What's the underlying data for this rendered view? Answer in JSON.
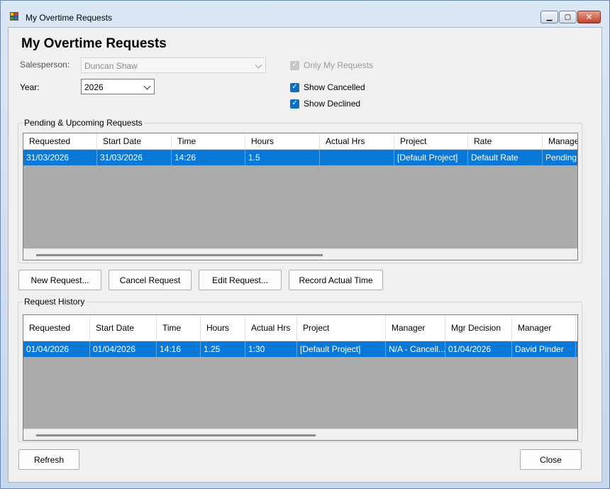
{
  "window": {
    "title": "My Overtime Requests"
  },
  "page_title": "My Overtime Requests",
  "filters": {
    "salesperson_label": "Salesperson:",
    "salesperson_value": "Duncan Shaw",
    "year_label": "Year:",
    "year_value": "2026",
    "only_my_requests": "Only My Requests",
    "show_cancelled": "Show Cancelled",
    "show_declined": "Show Declined"
  },
  "pending": {
    "title": "Pending & Upcoming Requests",
    "columns": [
      "Requested",
      "Start Date",
      "Time",
      "Hours",
      "Actual Hrs",
      "Project",
      "Rate",
      "Manager"
    ],
    "rows": [
      [
        "31/03/2026",
        "31/03/2026",
        "14:26",
        "1.5",
        "",
        "[Default Project]",
        "Default Rate",
        "Pending"
      ]
    ]
  },
  "actions": {
    "new_request": "New Request...",
    "cancel_request": "Cancel Request",
    "edit_request": "Edit Request...",
    "record_actual": "Record Actual Time"
  },
  "history": {
    "title": "Request History",
    "columns": [
      "Requested",
      "Start Date",
      "Time",
      "Hours",
      "Actual Hrs",
      "Project",
      "Manager",
      "Mgr Decision",
      "Manager"
    ],
    "rows": [
      [
        "01/04/2026",
        "01/04/2026",
        "14:16",
        "1.25",
        "1:30",
        "[Default Project]",
        "N/A - Cancell...",
        "01/04/2026",
        "David Pinder"
      ]
    ]
  },
  "footer": {
    "refresh": "Refresh",
    "close": "Close"
  },
  "colors": {
    "selection": "#0a78d7",
    "grid_bg": "#ababab",
    "checkbox": "#0d6fc2"
  }
}
